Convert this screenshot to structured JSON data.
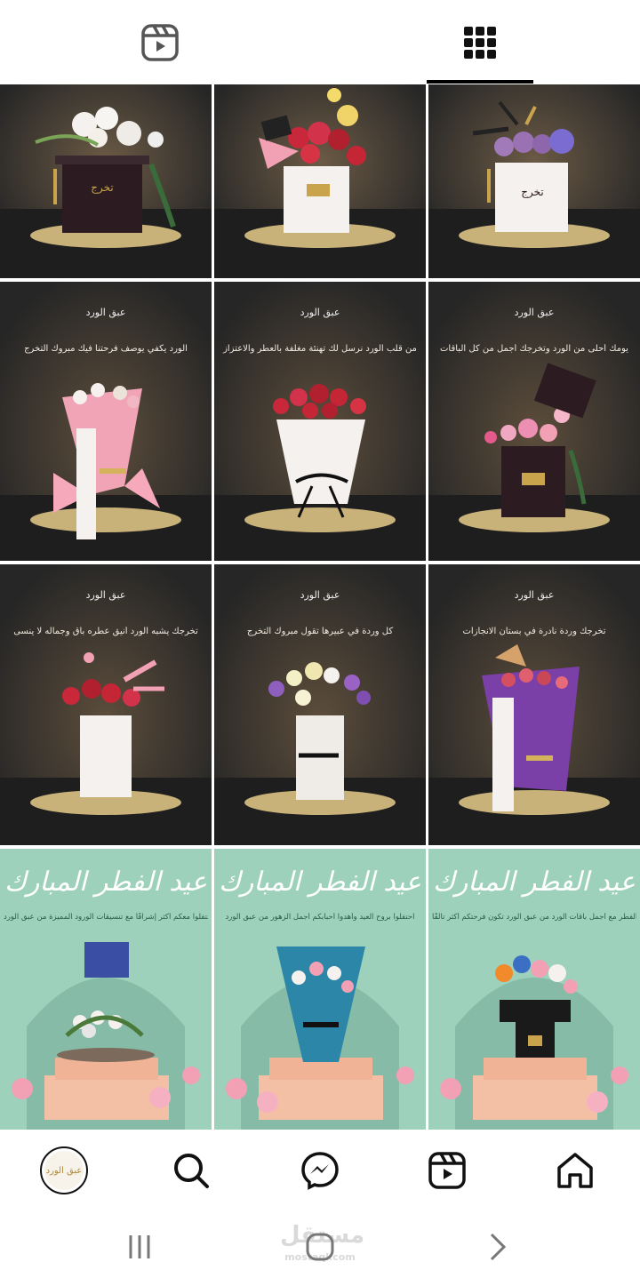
{
  "tabs": [
    {
      "name": "reels",
      "icon": "reels-tab-icon",
      "active": false
    },
    {
      "name": "grid",
      "icon": "grid-tab-icon",
      "active": true
    }
  ],
  "posts": [
    {
      "theme": "dark",
      "caption": "",
      "brand": "",
      "badge": "تخرج"
    },
    {
      "theme": "dark",
      "caption": "",
      "brand": "",
      "badge": ""
    },
    {
      "theme": "dark",
      "caption": "",
      "brand": "",
      "badge": "تخرج"
    },
    {
      "theme": "dark",
      "caption": "الورد يكفي يوصف فرحتنا فيك  مبروك التخرج",
      "brand": "عبق الورد"
    },
    {
      "theme": "dark",
      "caption": "من قلب الورد نرسل لك تهنئة مغلفة بالعطر والاعتزاز",
      "brand": "عبق الورد"
    },
    {
      "theme": "dark",
      "caption": "يومك أحلى من الورد وتخرجك أجمل من كل الباقات",
      "brand": "عبق الورد"
    },
    {
      "theme": "dark",
      "caption": "تخرجك يشبه الورد أنيق عطره باق وجماله لا ينسى",
      "brand": "عبق الورد"
    },
    {
      "theme": "dark",
      "caption": "كل وردة في عبيرها تقول مبروك التخرج",
      "brand": "عبق الورد"
    },
    {
      "theme": "dark",
      "caption": "تخرجك وردة نادرة في بستان الانجازات",
      "brand": "عبق الورد"
    },
    {
      "theme": "eid",
      "title": "عيد الفطر المبارك",
      "caption": "احتفلوا معكم أكثر إشراقًا مع تنسيقات الورود المميزة من عبق الورد"
    },
    {
      "theme": "eid",
      "title": "عيد الفطر المبارك",
      "caption": "احتفلوا بروح العيد وأهدوا أحبابكم أجمل الزهور من عبق الورد"
    },
    {
      "theme": "eid",
      "title": "عيد الفطر المبارك",
      "caption": "احتفلوا بعيد الفطر مع أجمل باقات الورد من عبق الورد تكون فرحتكم أكثر تألقًا"
    }
  ],
  "bottom_nav": {
    "profile_label": "عبق الورد",
    "items": [
      "profile-avatar",
      "search-icon",
      "messenger-icon",
      "reels-icon",
      "home-icon"
    ]
  },
  "system_nav": {
    "watermark": "مستقل",
    "watermark_sub": "mostaql.com"
  },
  "colors": {
    "dark_bg": "#2b2b2b",
    "eid_bg": "#9dd1bc",
    "gold": "#c9b27a",
    "accent_pink": "#f2a0b4"
  }
}
